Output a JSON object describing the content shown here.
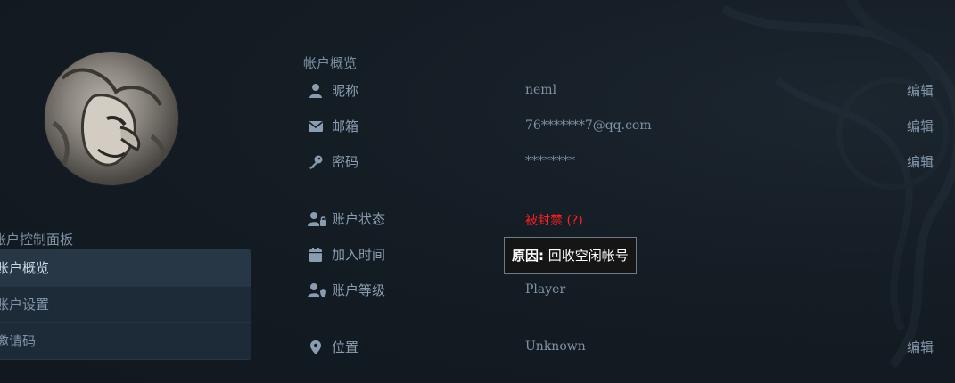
{
  "sidebar": {
    "title": "账户控制面板",
    "items": [
      {
        "label": "账户概览",
        "active": true
      },
      {
        "label": "账户设置",
        "active": false
      },
      {
        "label": "邀请码",
        "active": false
      }
    ]
  },
  "section": {
    "title": "帐户概览"
  },
  "rows": {
    "nickname": {
      "label": "昵称",
      "value": "neml",
      "edit": "编辑",
      "icon": "user-icon"
    },
    "email": {
      "label": "邮箱",
      "value": "76*******7@qq.com",
      "edit": "编辑",
      "icon": "envelope-icon"
    },
    "password": {
      "label": "密码",
      "value": "********",
      "edit": "编辑",
      "icon": "key-icon"
    },
    "status": {
      "label": "账户状态",
      "value": "被封禁 (?)",
      "icon": "user-lock-icon"
    },
    "join_time": {
      "label": "加入时间",
      "icon": "calendar-icon"
    },
    "level": {
      "label": "账户等级",
      "value": "Player",
      "icon": "user-shield-icon"
    },
    "location": {
      "label": "位置",
      "value": "Unknown",
      "edit": "编辑",
      "icon": "map-marker-icon"
    }
  },
  "tooltip": {
    "prefix": "原因:",
    "text": " 回收空闲帐号"
  },
  "colors": {
    "background": "#121a22",
    "text_muted": "#7f93a7",
    "banned_red": "#ff2020",
    "sidebar_active_bg": "#283746"
  }
}
